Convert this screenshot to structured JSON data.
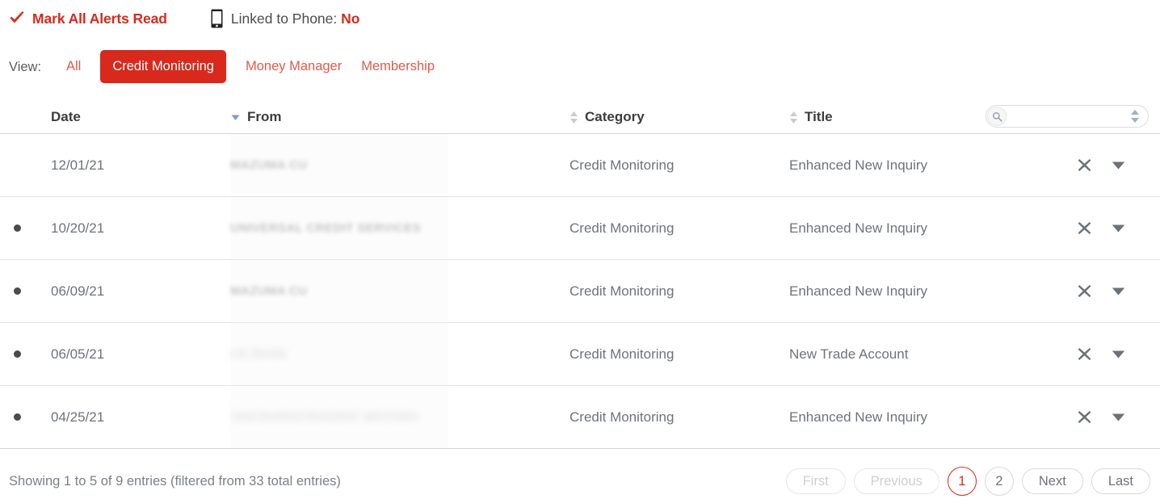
{
  "topbar": {
    "mark_all_read": "Mark All Alerts Read",
    "check_icon": "check-icon",
    "phone_icon": "mobile-phone-icon",
    "phone_label": "Linked to Phone:",
    "phone_value": "No"
  },
  "view": {
    "label": "View:",
    "tabs": [
      {
        "label": "All",
        "active": false
      },
      {
        "label": "Credit Monitoring",
        "active": true
      },
      {
        "label": "Money Manager",
        "active": false
      },
      {
        "label": "Membership",
        "active": false
      }
    ]
  },
  "search": {
    "value": "",
    "placeholder": "",
    "icon": "search-icon",
    "spinner_icon": "sort-updown-icon"
  },
  "table": {
    "columns": [
      {
        "key": "date",
        "label": "Date",
        "sort": "none"
      },
      {
        "key": "from",
        "label": "From",
        "sort": "desc"
      },
      {
        "key": "category",
        "label": "Category",
        "sort": "both"
      },
      {
        "key": "title",
        "label": "Title",
        "sort": "both"
      }
    ],
    "rows": [
      {
        "unread": false,
        "date": "12/01/21",
        "from": "MAZUMA CU",
        "from_redacted": true,
        "category": "Credit Monitoring",
        "title": "Enhanced New Inquiry"
      },
      {
        "unread": true,
        "date": "10/20/21",
        "from": "UNIVERSAL CREDIT SERVICES",
        "from_redacted": true,
        "category": "Credit Monitoring",
        "title": "Enhanced New Inquiry"
      },
      {
        "unread": true,
        "date": "06/09/21",
        "from": "MAZUMA CU",
        "from_redacted": true,
        "category": "Credit Monitoring",
        "title": "Enhanced New Inquiry"
      },
      {
        "unread": true,
        "date": "06/05/21",
        "from": "US BANK",
        "from_redacted": true,
        "category": "Credit Monitoring",
        "title": "New Trade Account"
      },
      {
        "unread": true,
        "date": "04/25/21",
        "from": "700CRARISTROCRAT MOTORS",
        "from_redacted": true,
        "category": "Credit Monitoring",
        "title": "Enhanced New Inquiry"
      }
    ],
    "row_actions": {
      "dismiss_icon": "close-x-icon",
      "expand_icon": "chevron-down-icon"
    }
  },
  "footer": {
    "entries_info": "Showing 1 to 5 of 9 entries (filtered from 33 total entries)",
    "pagination": [
      {
        "label": "First",
        "state": "disabled",
        "kind": "text"
      },
      {
        "label": "Previous",
        "state": "disabled",
        "kind": "text"
      },
      {
        "label": "1",
        "state": "active",
        "kind": "num"
      },
      {
        "label": "2",
        "state": "normal",
        "kind": "num"
      },
      {
        "label": "Next",
        "state": "normal",
        "kind": "text"
      },
      {
        "label": "Last",
        "state": "normal",
        "kind": "text"
      }
    ]
  },
  "colors": {
    "brand_red": "#d8291c",
    "link_red": "#e05a4c",
    "text_gray": "#6f7479",
    "header_gray": "#3d3d3d",
    "sort_blue": "#7b9bd6"
  }
}
